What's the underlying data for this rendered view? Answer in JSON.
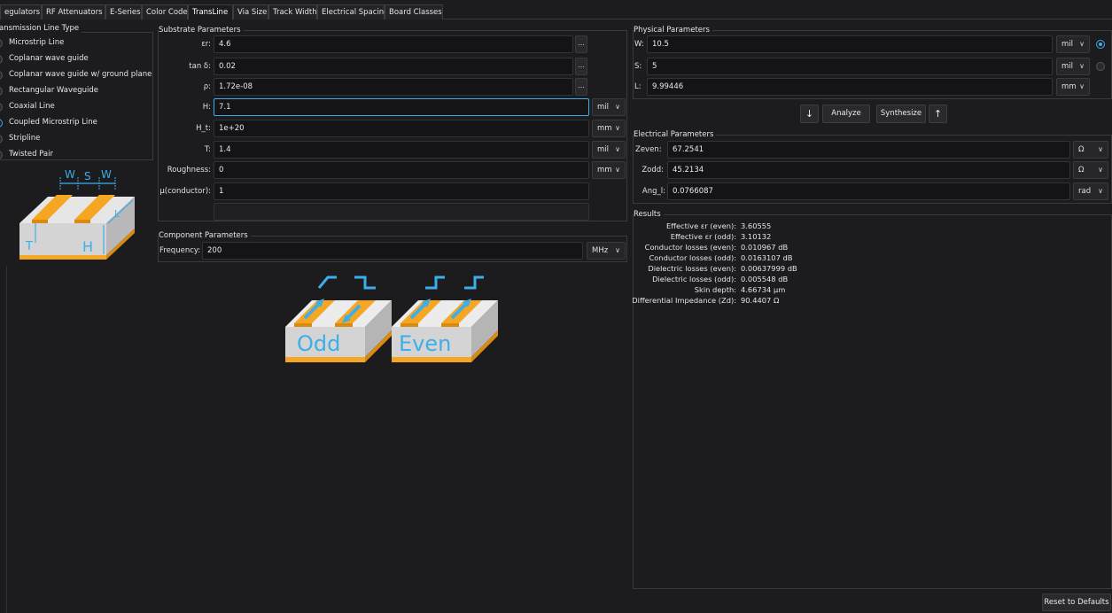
{
  "tabs": [
    {
      "label": "egulators",
      "active": false
    },
    {
      "label": "RF Attenuators",
      "active": false
    },
    {
      "label": "E-Series",
      "active": false
    },
    {
      "label": "Color Code",
      "active": false
    },
    {
      "label": "TransLine",
      "active": true
    },
    {
      "label": "Via Size",
      "active": false
    },
    {
      "label": "Track Width",
      "active": false
    },
    {
      "label": "Electrical Spacing",
      "active": false
    },
    {
      "label": "Board Classes",
      "active": false
    }
  ],
  "line_type": {
    "title": "ansmission Line Type",
    "options": [
      {
        "label": "Microstrip Line",
        "selected": false
      },
      {
        "label": "Coplanar wave guide",
        "selected": false
      },
      {
        "label": "Coplanar wave guide w/ ground plane",
        "selected": false
      },
      {
        "label": "Rectangular Waveguide",
        "selected": false
      },
      {
        "label": "Coaxial Line",
        "selected": false
      },
      {
        "label": "Coupled Microstrip Line",
        "selected": true
      },
      {
        "label": "Stripline",
        "selected": false
      },
      {
        "label": "Twisted Pair",
        "selected": false
      }
    ]
  },
  "diagram_small": {
    "w_label": "W",
    "s_label": "S",
    "w2_label": "W",
    "t_label": "T",
    "h_label": "H",
    "l_label": "L"
  },
  "substrate": {
    "title": "Substrate Parameters",
    "er": {
      "label": "εr:",
      "value": "4.6",
      "button": "..."
    },
    "tand": {
      "label": "tan δ:",
      "value": "0.02",
      "button": "..."
    },
    "rho": {
      "label": "ρ:",
      "value": "1.72e-08",
      "button": "..."
    },
    "h": {
      "label": "H:",
      "value": "7.1",
      "unit": "mil"
    },
    "h_t": {
      "label": "H_t:",
      "value": "1e+20",
      "unit": "mm"
    },
    "t": {
      "label": "T:",
      "value": "1.4",
      "unit": "mil"
    },
    "roughness": {
      "label": "Roughness:",
      "value": "0",
      "unit": "mm"
    },
    "mu": {
      "label": "μ(conductor):",
      "value": "1"
    }
  },
  "component": {
    "title": "Component Parameters",
    "freq": {
      "label": "Frequency:",
      "value": "200",
      "unit": "MHz"
    }
  },
  "modes": {
    "odd": "Odd",
    "even": "Even"
  },
  "physical": {
    "title": "Physical Parameters",
    "w": {
      "label": "W:",
      "value": "10.5",
      "unit": "mil",
      "selected": true
    },
    "s": {
      "label": "S:",
      "value": "5",
      "unit": "mil",
      "selected": false
    },
    "l": {
      "label": "L:",
      "value": "9.99446",
      "unit": "mm"
    }
  },
  "actions": {
    "down": "↓",
    "analyze": "Analyze",
    "synthesize": "Synthesize",
    "up": "↑"
  },
  "electrical": {
    "title": "Electrical Parameters",
    "zeven": {
      "label": "Zeven:",
      "value": "67.2541",
      "unit": "Ω"
    },
    "zodd": {
      "label": "Zodd:",
      "value": "45.2134",
      "unit": "Ω"
    },
    "ang": {
      "label": "Ang_l:",
      "value": "0.0766087",
      "unit": "rad"
    }
  },
  "results": {
    "title": "Results",
    "rows": [
      {
        "label": "Effective εr (even):",
        "value": "3.60555"
      },
      {
        "label": "Effective εr (odd):",
        "value": "3.10132"
      },
      {
        "label": "Conductor losses (even):",
        "value": "0.010967 dB"
      },
      {
        "label": "Conductor losses (odd):",
        "value": "0.0163107 dB"
      },
      {
        "label": "Dielectric losses (even):",
        "value": "0.00637999 dB"
      },
      {
        "label": "Dielectric losses (odd):",
        "value": "0.005548 dB"
      },
      {
        "label": "Skin depth:",
        "value": "4.66734 μm"
      },
      {
        "label": "Differential Impedance (Zd):",
        "value": "90.4407 Ω"
      }
    ]
  },
  "reset_label": "Reset to Defaults",
  "colors": {
    "accent": "#3daee9",
    "copper": "#f5a623",
    "box_face": "#d9d9d9",
    "box_side": "#b3b3b3"
  }
}
